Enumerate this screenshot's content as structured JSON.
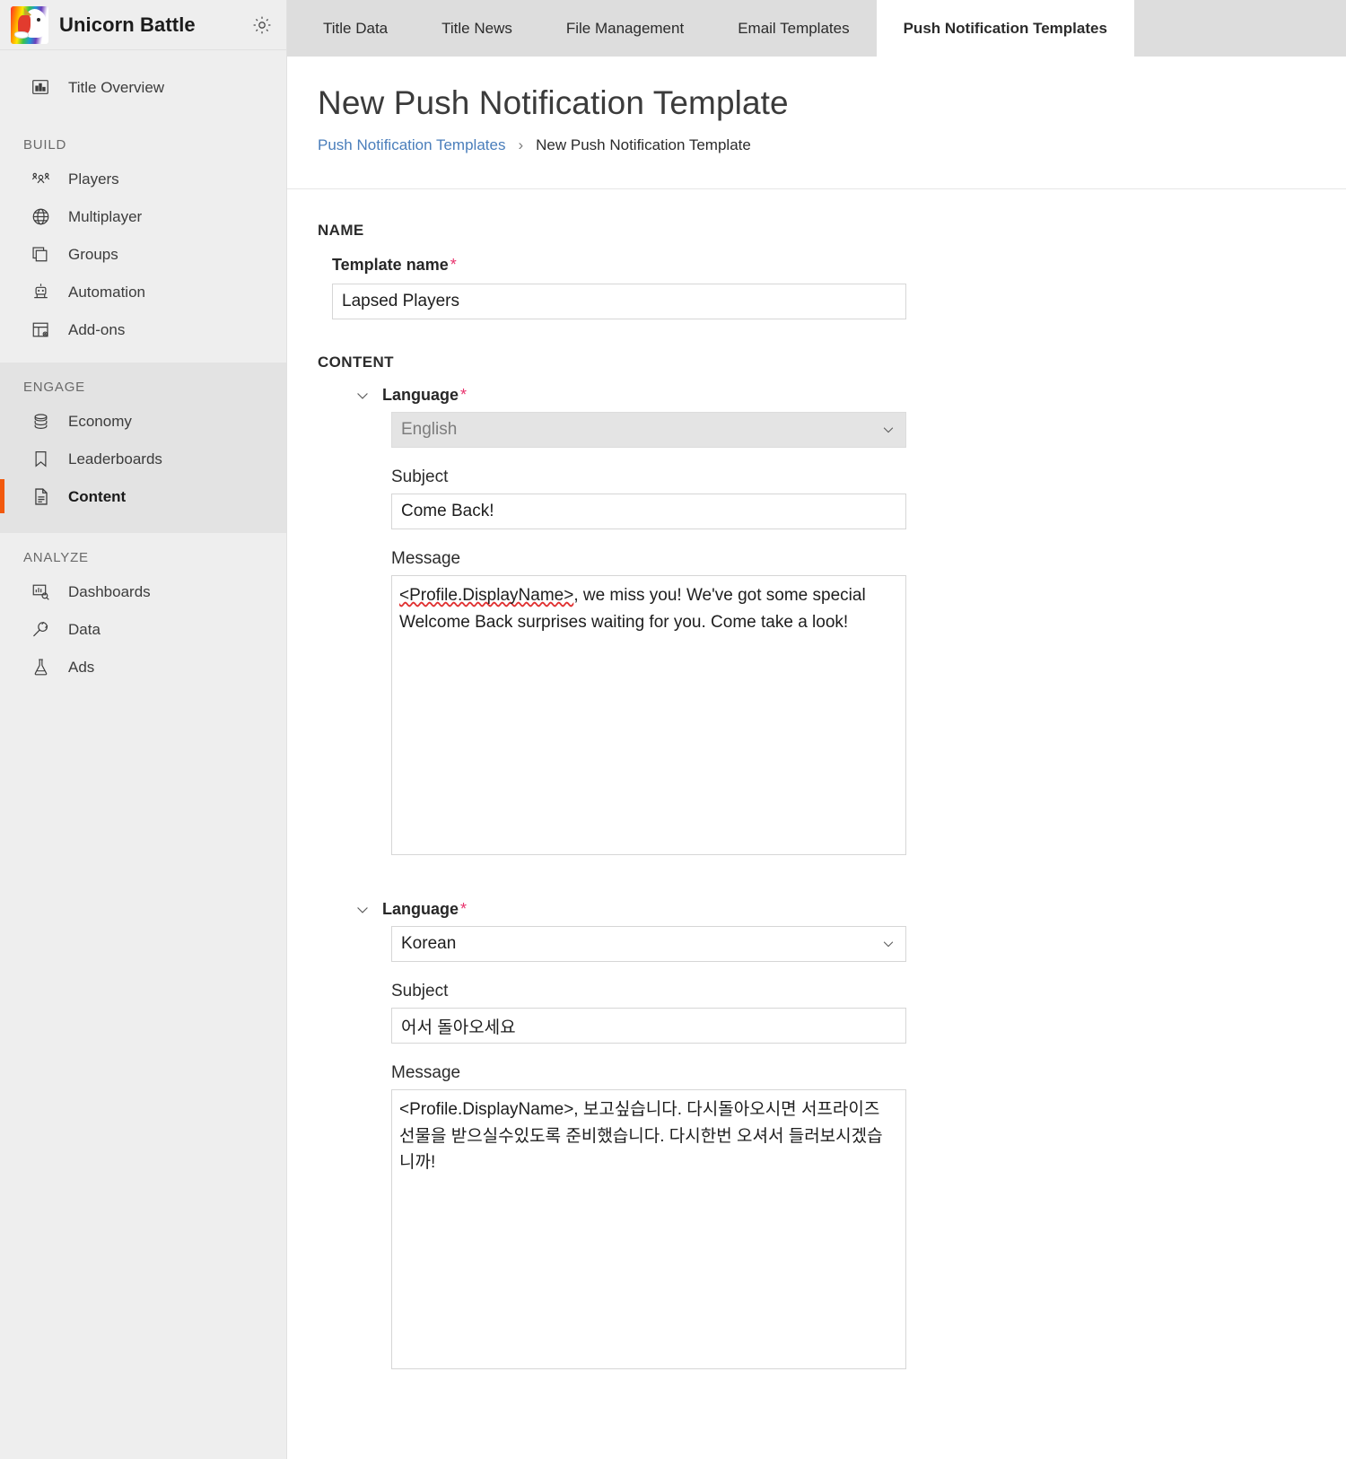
{
  "sidebar": {
    "brand": {
      "title": "Unicorn Battle",
      "logo_icon": "unicorn-logo",
      "settings_icon": "gear-icon"
    },
    "top_item": {
      "label": "Title Overview",
      "icon": "bar-chart-icon"
    },
    "groups": [
      {
        "title": "BUILD",
        "items": [
          {
            "label": "Players",
            "icon": "players-icon"
          },
          {
            "label": "Multiplayer",
            "icon": "globe-icon"
          },
          {
            "label": "Groups",
            "icon": "layers-icon"
          },
          {
            "label": "Automation",
            "icon": "robot-icon"
          },
          {
            "label": "Add-ons",
            "icon": "addons-icon"
          }
        ]
      },
      {
        "title": "ENGAGE",
        "items": [
          {
            "label": "Economy",
            "icon": "coins-icon"
          },
          {
            "label": "Leaderboards",
            "icon": "bookmark-icon"
          },
          {
            "label": "Content",
            "icon": "document-icon"
          }
        ]
      },
      {
        "title": "ANALYZE",
        "items": [
          {
            "label": "Dashboards",
            "icon": "dashboard-search-icon"
          },
          {
            "label": "Data",
            "icon": "plug-icon"
          },
          {
            "label": "Ads",
            "icon": "flask-icon"
          }
        ]
      }
    ],
    "active_item": "Content",
    "active_accent_color": "#f2590d"
  },
  "tabs": [
    {
      "label": "Title Data"
    },
    {
      "label": "Title News"
    },
    {
      "label": "File Management"
    },
    {
      "label": "Email Templates"
    },
    {
      "label": "Push Notification Templates"
    }
  ],
  "active_tab": "Push Notification Templates",
  "page": {
    "title": "New Push Notification Template",
    "breadcrumb": {
      "link": "Push Notification Templates",
      "separator": "›",
      "current": "New Push Notification Template"
    }
  },
  "form": {
    "name_section": {
      "heading": "NAME",
      "template_name_label": "Template name",
      "required_mark": "*",
      "template_name_value": "Lapsed Players",
      "template_name_placeholder": "Template name"
    },
    "content_section": {
      "heading": "CONTENT",
      "languages": [
        {
          "label": "Language",
          "required_mark": "*",
          "chevron_icon": "chevron-down-icon",
          "select_value": "English",
          "select_disabled": true,
          "subject_label": "Subject",
          "subject_value": "Come Back!",
          "message_label": "Message",
          "message_value": "<Profile.DisplayName>, we miss you! We've got some special Welcome Back surprises waiting for you. Come take a look!",
          "message_token": "<Profile.DisplayName>",
          "message_rest": ", we miss you! We've got some special Welcome Back surprises waiting for you. Come take a look!"
        },
        {
          "label": "Language",
          "required_mark": "*",
          "chevron_icon": "chevron-down-icon",
          "select_value": "Korean",
          "select_disabled": false,
          "subject_label": "Subject",
          "subject_value": "어서 돌아오세요",
          "message_label": "Message",
          "message_value": "<Profile.DisplayName>, 보고싶습니다. 다시돌아오시면 서프라이즈 선물을 받으실수있도록 준비했습니다. 다시한번 오셔서 들러보시겠습니까!"
        }
      ]
    }
  },
  "colors": {
    "accent_orange": "#f2590d",
    "link_blue": "#4a7ebb",
    "required_pink": "#e8336d",
    "sidebar_bg": "#eeeeee",
    "sidebar_group_active_bg": "#e3e3e3",
    "tabbar_bg": "#dddddd"
  }
}
